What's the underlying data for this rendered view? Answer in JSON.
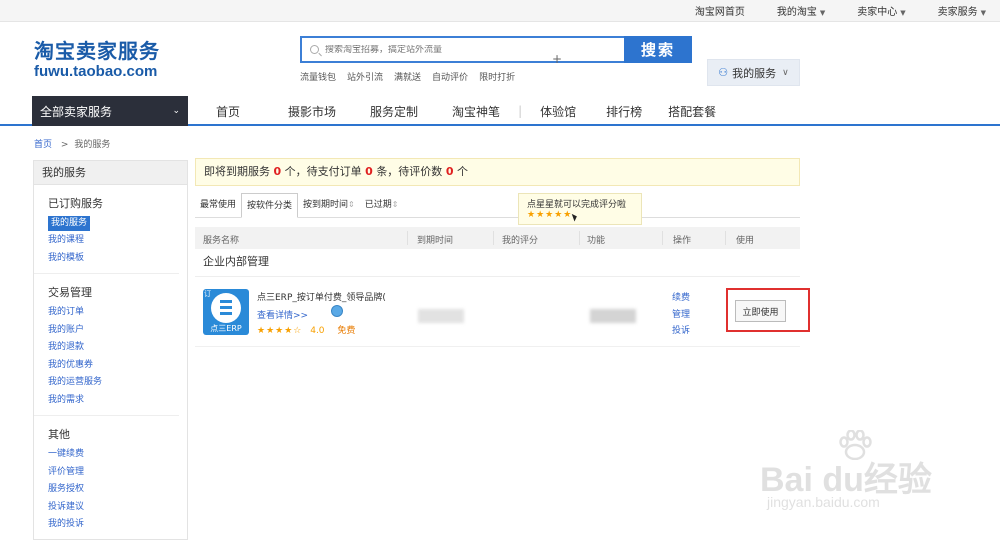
{
  "topbar": {
    "items": [
      {
        "label": "淘宝网首页",
        "dropdown": false
      },
      {
        "label": "我的淘宝",
        "dropdown": true
      },
      {
        "label": "卖家中心",
        "dropdown": true
      },
      {
        "label": "卖家服务",
        "dropdown": true
      }
    ]
  },
  "header": {
    "logo_cn": "淘宝卖家服务",
    "logo_en": "fuwu.taobao.com",
    "search_placeholder": "搜索淘宝招募，搞定站外流量",
    "search_button": "搜索",
    "hot_links": [
      "流量钱包",
      "站外引流",
      "满就送",
      "自动评价",
      "限时打折"
    ],
    "my_service_label": "我的服务"
  },
  "nav": {
    "all_label": "全部卖家服务",
    "items": [
      "首页",
      "摄影市场",
      "服务定制",
      "淘宝神笔",
      "体验馆",
      "排行榜",
      "搭配套餐"
    ]
  },
  "breadcrumb": {
    "home": "首页",
    "sep": ">",
    "current": "我的服务"
  },
  "sidebar": {
    "title": "我的服务",
    "groups": [
      {
        "title": "已订购服务",
        "items": [
          "我的服务",
          "我的课程",
          "我的模板"
        ],
        "active": 0
      },
      {
        "title": "交易管理",
        "items": [
          "我的订单",
          "我的账户",
          "我的退款",
          "我的优惠券",
          "我的运营服务",
          "我的需求"
        ],
        "active": -1
      },
      {
        "title": "其他",
        "items": [
          "一键续费",
          "评价管理",
          "服务授权",
          "投诉建议",
          "我的投诉"
        ],
        "active": -1
      }
    ]
  },
  "notice": {
    "pre": "即将到期服务",
    "expiring": "0",
    "mid1": "个，待支付订单",
    "unpaid": "0",
    "mid2": "条，待评价数",
    "to_rate": "0",
    "post": "个"
  },
  "tabs": [
    {
      "label": "最常使用",
      "arrow": ""
    },
    {
      "label": "按软件分类",
      "arrow": ""
    },
    {
      "label": "按到期时间",
      "arrow": "⇕"
    },
    {
      "label": "已过期",
      "arrow": "⇕"
    }
  ],
  "tooltip": {
    "text": "点星星就可以完成评分啦",
    "stars": "★★★★★"
  },
  "table": {
    "headers": [
      "服务名称",
      "到期时间",
      "我的评分",
      "功能",
      "操作",
      "使用"
    ]
  },
  "section_title": "企业内部管理",
  "app": {
    "icon_text": "点三ERP",
    "icon_corner": "订",
    "name": "点三ERP_按订单付费_领导品牌(",
    "detail_link": "查看详情>>",
    "stars": "★★★★☆",
    "score": "4.0",
    "price": "免费",
    "ops": [
      "续费",
      "管理",
      "投诉"
    ],
    "use_button": "立即使用"
  },
  "watermark": {
    "main": "Bai du经验",
    "sub": "jingyan.baidu.com"
  },
  "colors": {
    "accent": "#2d74cf",
    "notice_num": "#e02020",
    "highlight_box": "#e0302f"
  }
}
